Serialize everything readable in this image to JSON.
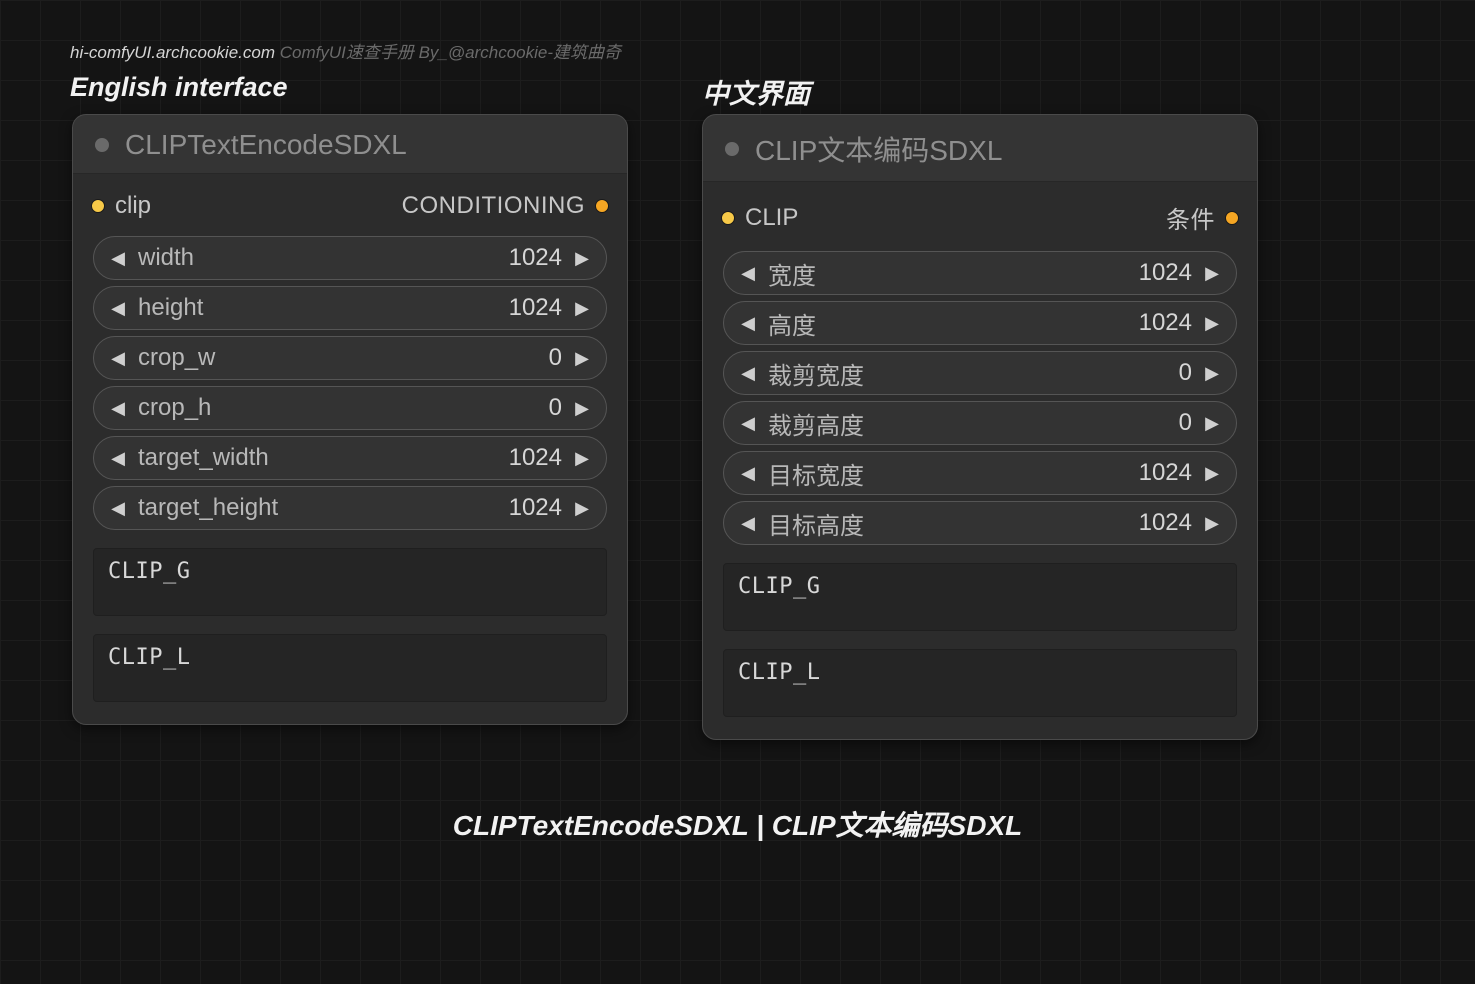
{
  "watermark": {
    "site": "hi-comfyUI.archcookie.com",
    "rest": " ComfyUI速查手册 By_@archcookie-建筑曲奇"
  },
  "labels": {
    "english": "English interface",
    "chinese": "中文界面"
  },
  "footer": "CLIPTextEncodeSDXL | CLIP文本编码SDXL",
  "en": {
    "title": "CLIPTextEncodeSDXL",
    "input_port": "clip",
    "output_port": "CONDITIONING",
    "params": [
      {
        "name": "width",
        "value": "1024"
      },
      {
        "name": "height",
        "value": "1024"
      },
      {
        "name": "crop_w",
        "value": "0"
      },
      {
        "name": "crop_h",
        "value": "0"
      },
      {
        "name": "target_width",
        "value": "1024"
      },
      {
        "name": "target_height",
        "value": "1024"
      }
    ],
    "text_g": "CLIP_G",
    "text_l": "CLIP_L"
  },
  "zh": {
    "title": "CLIP文本编码SDXL",
    "input_port": "CLIP",
    "output_port": "条件",
    "params": [
      {
        "name": "宽度",
        "value": "1024"
      },
      {
        "name": "高度",
        "value": "1024"
      },
      {
        "name": "裁剪宽度",
        "value": "0"
      },
      {
        "name": "裁剪高度",
        "value": "0"
      },
      {
        "name": "目标宽度",
        "value": "1024"
      },
      {
        "name": "目标高度",
        "value": "1024"
      }
    ],
    "text_g": "CLIP_G",
    "text_l": "CLIP_L"
  }
}
